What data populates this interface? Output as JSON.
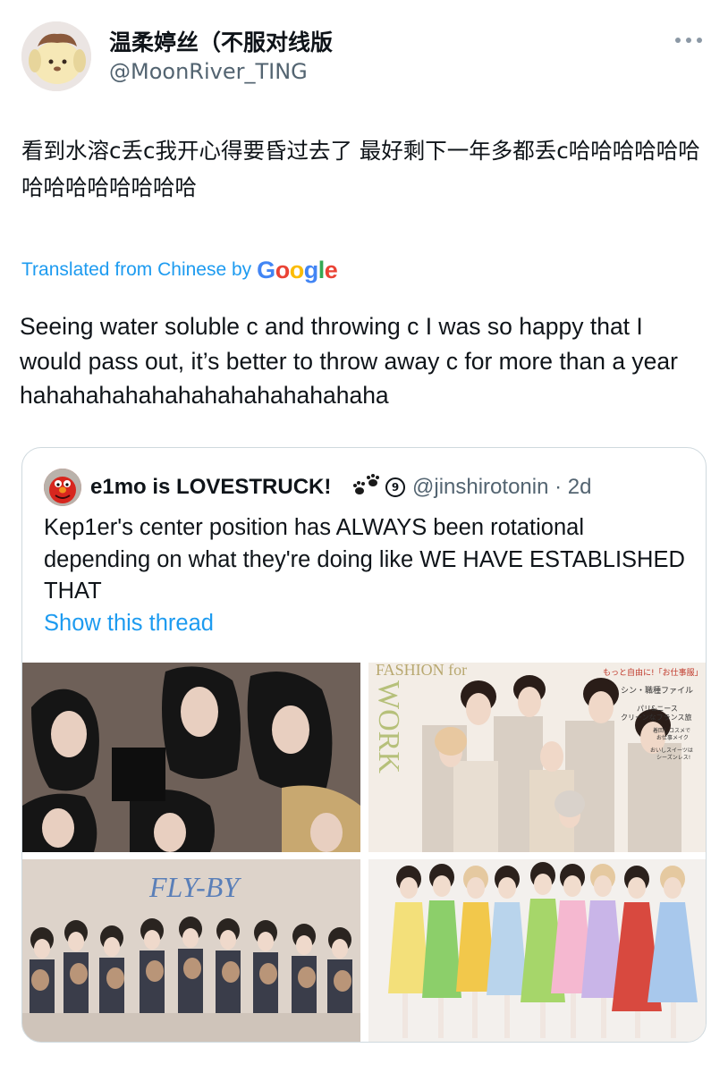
{
  "tweet": {
    "author": {
      "display_name": "温柔婷丝（不服对线版",
      "handle": "@MoonRiver_TING"
    },
    "original_text": "看到水溶c丢c我开心得要昏过去了 最好剩下一年多都丢c哈哈哈哈哈哈哈哈哈哈哈哈哈哈",
    "translation_label": "Translated from Chinese by",
    "translation_provider": "Google",
    "translated_text": "Seeing water soluble c and throwing c I was so happy that I would pass out, it’s better to throw away c for more than a year hahahahahahahahahahahahahaha"
  },
  "quote": {
    "author": {
      "display_name": "e1mo is LOVESTRUCK!",
      "badge": "9",
      "handle_time": "@jinshirotonin · 2d"
    },
    "text": "Kep1er's center position has ALWAYS been rotational depending on what they're doing like WE HAVE ESTABLISHED THAT",
    "show_thread": "Show this thread",
    "photo2": {
      "masthead": "FASHION for WORK",
      "caption": "もっと自由に!「お仕事服」\nシン・職種ファイル\nパリ&ニース\nクリーンなフランス旅\n着回しコスメで\nお仕事メイク\nおいしスイーツは\nシーズンレス!"
    },
    "photo3": {
      "logo": "FLY-BY"
    }
  },
  "colors": {
    "accent": "#1d9bf0",
    "secondary_text": "#536471",
    "border": "#cfd9de"
  },
  "icons": {
    "more": "more-horizontal-icon",
    "quote_emoji": "paw-prints-icon"
  }
}
